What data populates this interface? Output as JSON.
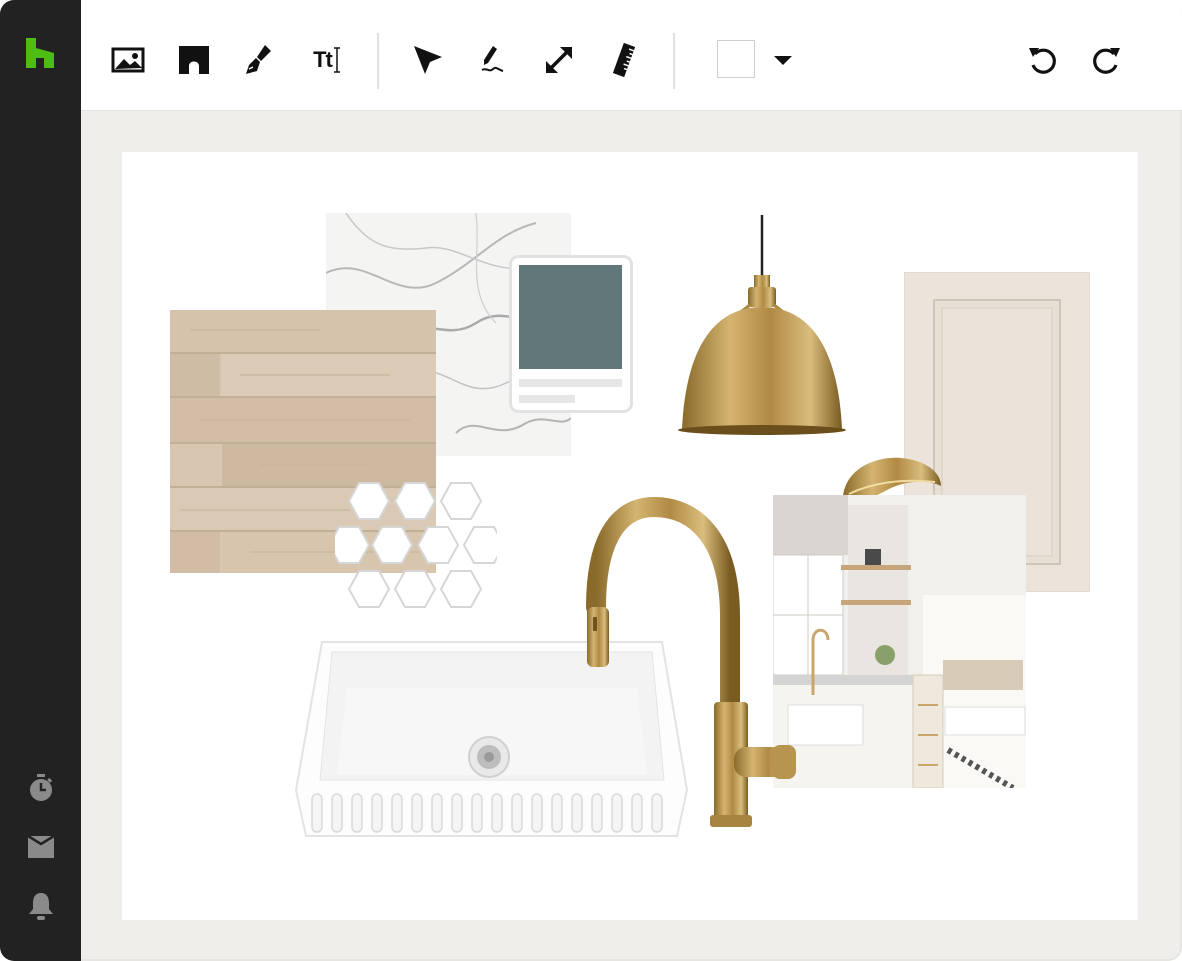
{
  "app": {
    "brand": "houzz",
    "brand_color": "#4dbc15",
    "sidebar_color": "#222222",
    "canvas_background": "#efeeea"
  },
  "toolbar": {
    "tools": [
      {
        "name": "image-tool",
        "icon": "image-icon"
      },
      {
        "name": "shape-tool",
        "icon": "arch-shape-icon"
      },
      {
        "name": "paint-tool",
        "icon": "paintbrush-icon"
      },
      {
        "name": "text-tool",
        "icon": "text-icon",
        "label": "Tt"
      },
      {
        "name": "select-tool",
        "icon": "pointer-arrow-icon"
      },
      {
        "name": "draw-tool",
        "icon": "pen-icon"
      },
      {
        "name": "resize-tool",
        "icon": "resize-arrow-icon"
      },
      {
        "name": "measure-tool",
        "icon": "ruler-icon"
      }
    ],
    "fill_color": "#ffffff",
    "history": [
      {
        "name": "undo-button",
        "icon": "undo-icon"
      },
      {
        "name": "redo-button",
        "icon": "redo-icon"
      }
    ]
  },
  "sidebar": {
    "items": [
      {
        "name": "history-timer",
        "icon": "stopwatch-icon"
      },
      {
        "name": "inbox",
        "icon": "inbox-icon"
      },
      {
        "name": "notifications",
        "icon": "bell-icon"
      }
    ]
  },
  "moodboard": {
    "paint_color": "#62777a",
    "items": [
      "light-oak-wood-flooring",
      "white-marble-countertop",
      "paint-swatch-card",
      "brass-pendant-light",
      "cream-cabinet-door",
      "brass-cup-pull",
      "white-hexagon-tile",
      "brass-pull-down-faucet",
      "kitchen-inspiration-photo",
      "white-farmhouse-sink"
    ]
  }
}
